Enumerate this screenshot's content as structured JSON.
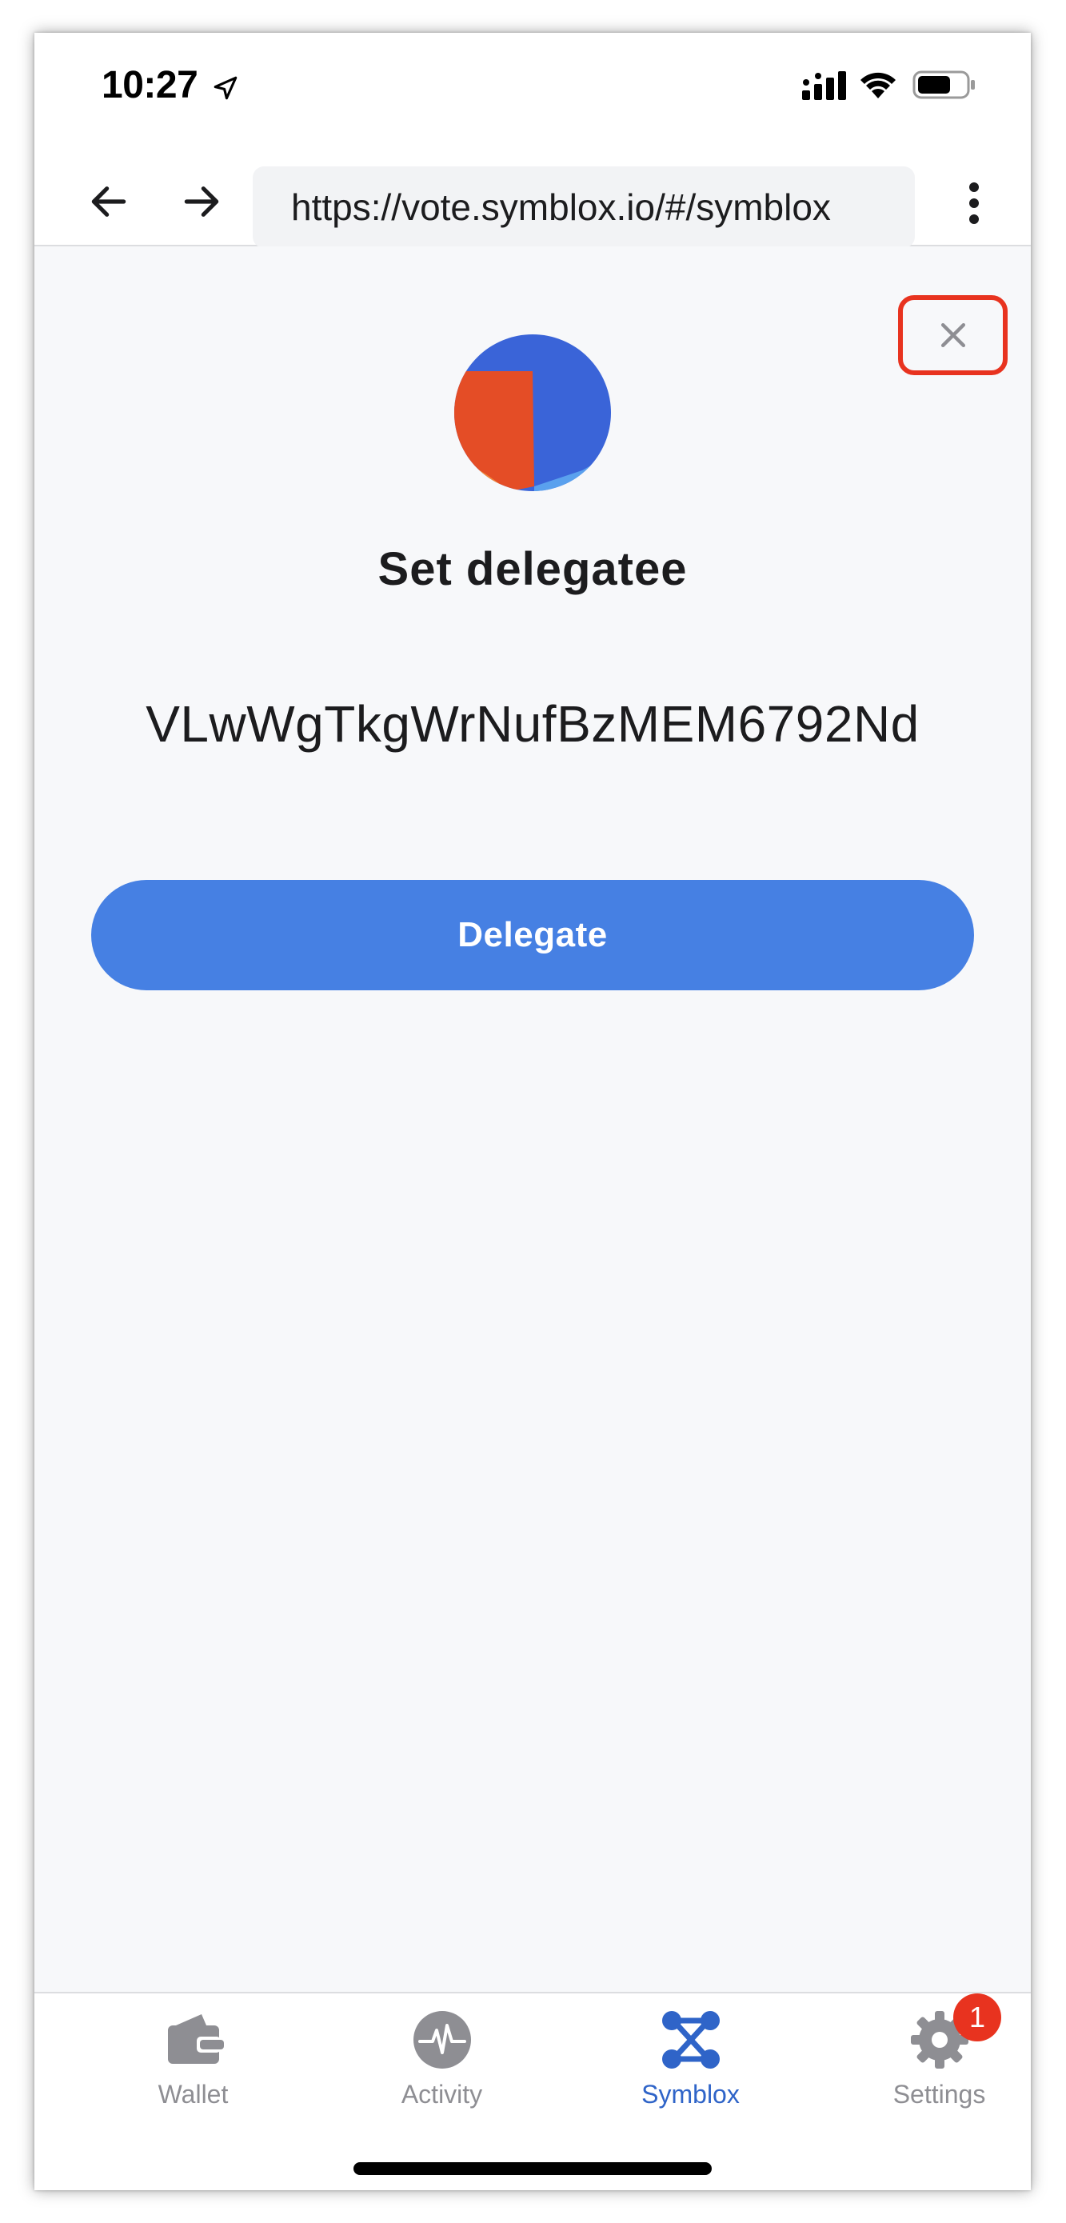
{
  "status_bar": {
    "time": "10:27",
    "icons": [
      "location-arrow-icon",
      "signal-icon",
      "wifi-icon",
      "battery-icon"
    ]
  },
  "browser": {
    "url": "https://vote.symblox.io/#/symblox",
    "icons": [
      "back-arrow-icon",
      "forward-arrow-icon",
      "more-vertical-icon"
    ]
  },
  "modal": {
    "title": "Set delegatee",
    "address": "VLwWgTkgWrNufBzMEM6792Nd",
    "delegate_label": "Delegate",
    "close_icon": "close-icon",
    "avatar_colors": [
      "#3a64d8",
      "#e44d26",
      "#5aa1ee",
      "#f08a3c"
    ]
  },
  "tabs": [
    {
      "label": "Wallet",
      "icon": "wallet-icon",
      "active": false
    },
    {
      "label": "Activity",
      "icon": "activity-icon",
      "active": false
    },
    {
      "label": "Symblox",
      "icon": "symblox-icon",
      "active": true
    },
    {
      "label": "Settings",
      "icon": "gear-icon",
      "active": false,
      "badge": "1"
    }
  ],
  "colors": {
    "primary_button": "#4680e3",
    "active_tab": "#2f64c8",
    "inactive_tab": "#8e8e93",
    "highlight": "#e8331f",
    "badge": "#e8331f",
    "background": "#f7f8fa"
  }
}
